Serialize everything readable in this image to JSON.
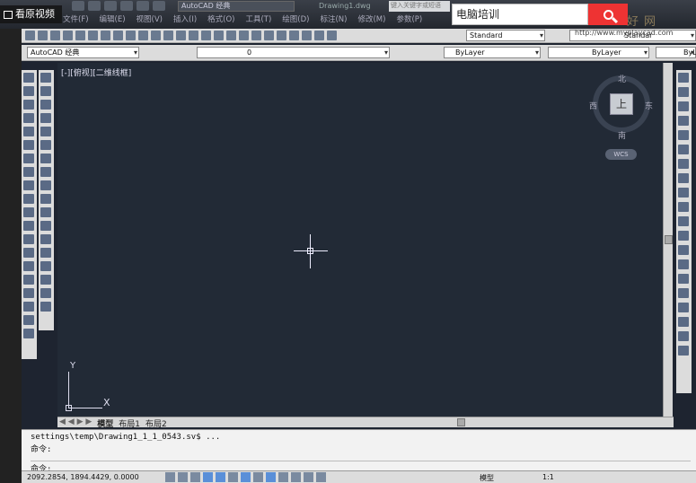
{
  "overlay": {
    "label": "看原视频"
  },
  "window": {
    "workspace": "AutoCAD 经典",
    "doc_title": "Drawing1.dwg",
    "help_placeholder": "键入关键字或短语"
  },
  "menu": [
    "文件(F)",
    "编辑(E)",
    "视图(V)",
    "插入(I)",
    "格式(O)",
    "工具(T)",
    "绘图(D)",
    "标注(N)",
    "修改(M)",
    "参数(P)"
  ],
  "search": {
    "value": "电脑培训"
  },
  "watermark": {
    "brand": "好网",
    "url": "http://www.myplaycad.com"
  },
  "toolbar": {
    "text_style": "Standard",
    "dim_style": "Standar",
    "workspace_combo": "AutoCAD 经典",
    "layer": "0",
    "color": "ByLayer",
    "linetype": "ByLayer",
    "lineweight": "ByL"
  },
  "viewport": {
    "label": "[-][俯视][二维线框]"
  },
  "viewcube": {
    "north": "北",
    "south": "南",
    "east": "东",
    "west": "西",
    "face": "上",
    "wcs": "WCS"
  },
  "ucs": {
    "x": "X",
    "y": "Y"
  },
  "tabs": [
    "模型",
    "布局1",
    "布局2"
  ],
  "command": {
    "history1": "settings\\temp\\Drawing1_1_1_0543.sv$ ...",
    "history2": "命令:",
    "prompt": "命令:"
  },
  "status": {
    "coords": "2092.2854, 1894.4429, 0.0000",
    "model": "模型",
    "scale": "1:1"
  },
  "colors": {
    "canvas": "#222a36",
    "search_button": "#e33333"
  }
}
